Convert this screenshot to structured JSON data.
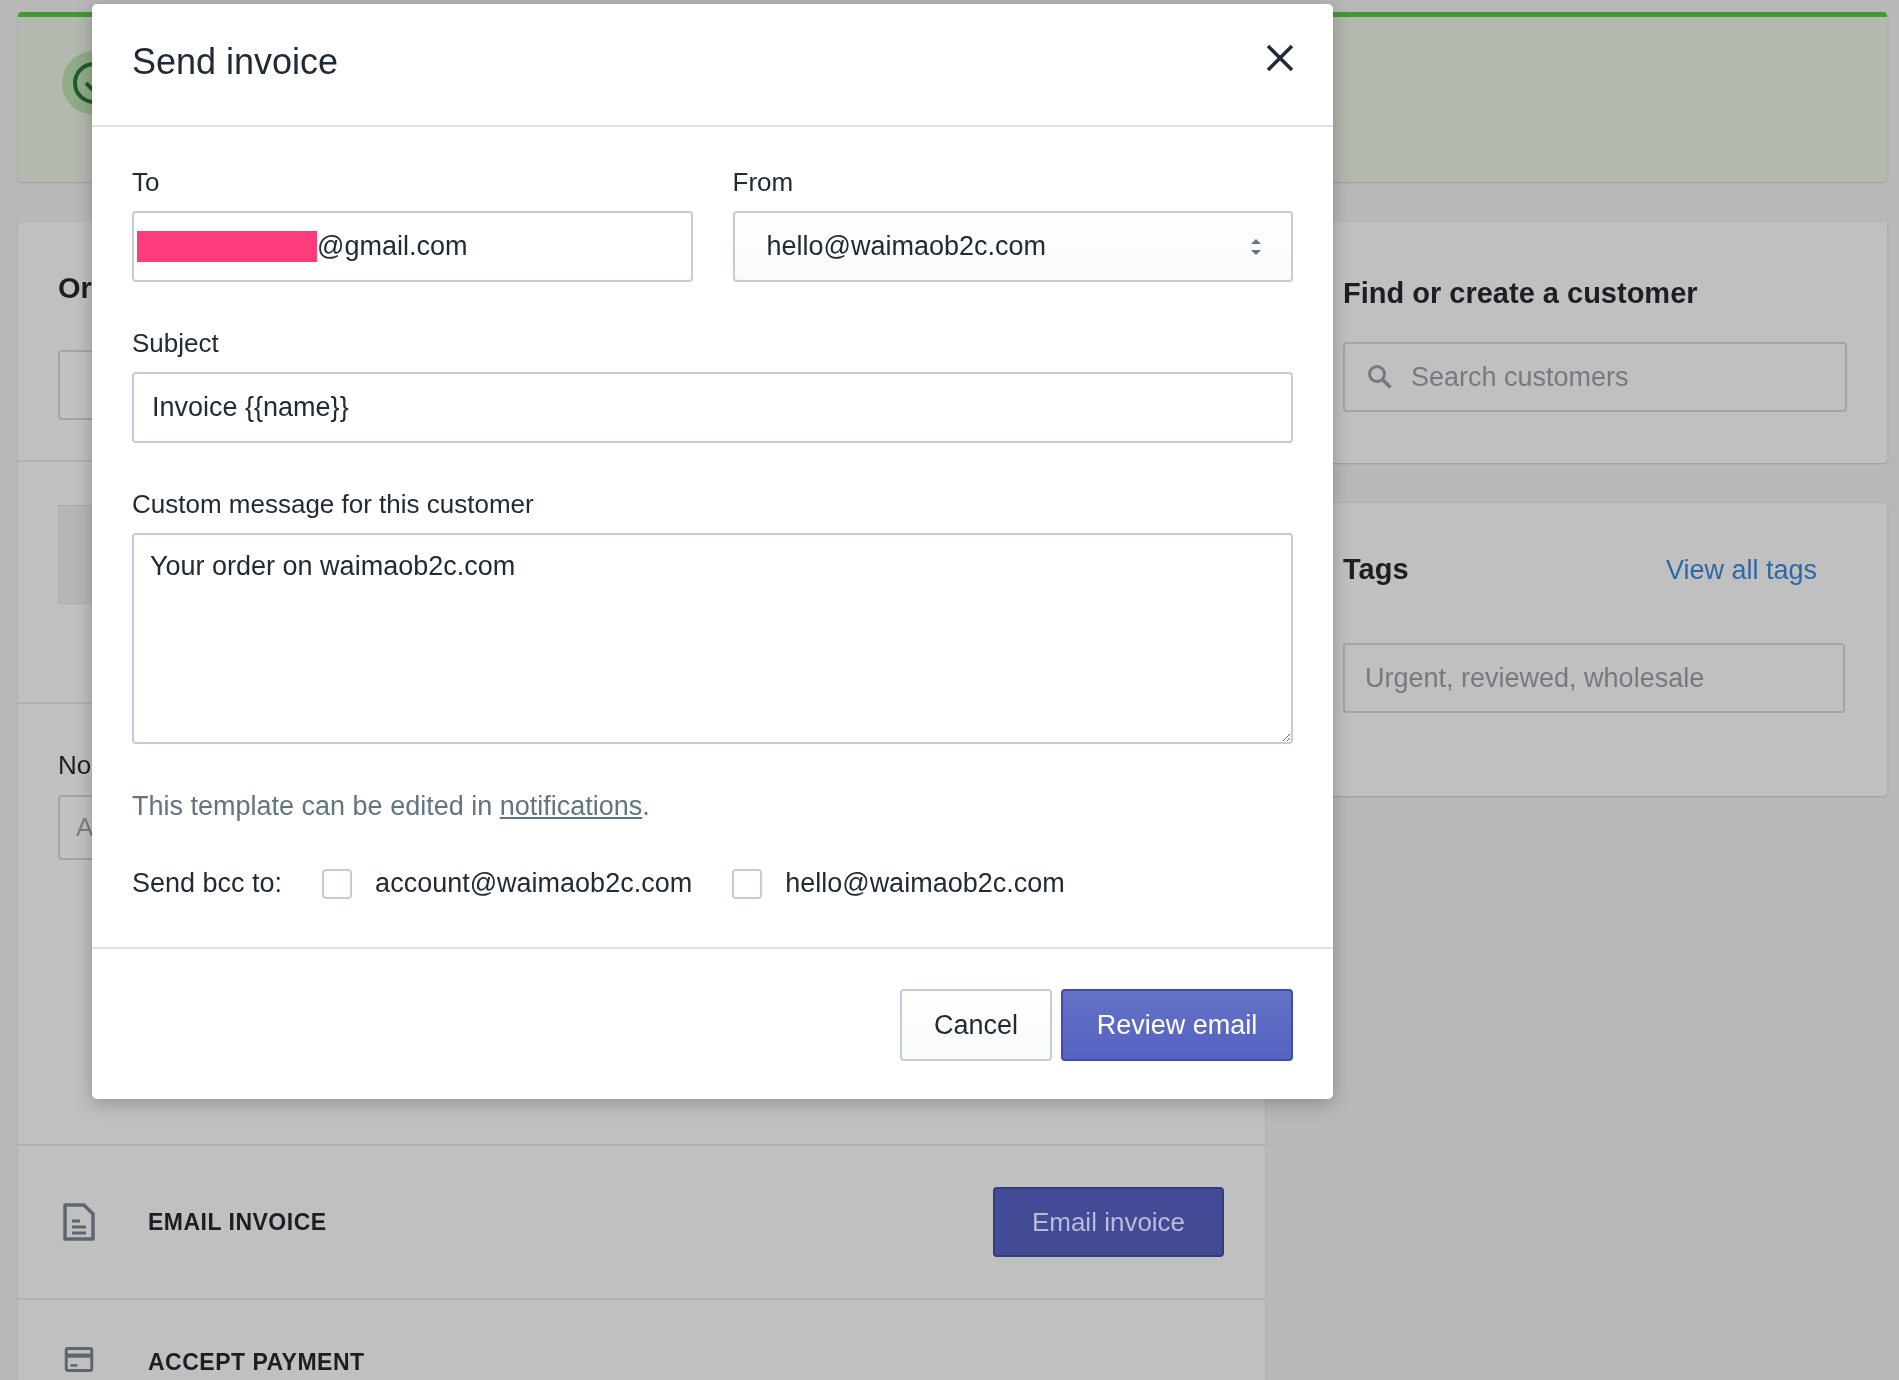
{
  "order_card": {
    "title": "Or",
    "notes_label": "No",
    "notes_placeholder": "A"
  },
  "email_invoice": {
    "label": "EMAIL INVOICE",
    "button": "Email invoice"
  },
  "accept_payment": {
    "label": "ACCEPT PAYMENT"
  },
  "customer_card": {
    "title": "Find or create a customer",
    "search": {
      "placeholder": "Search customers"
    }
  },
  "tags_card": {
    "title": "Tags",
    "link": "View all tags",
    "field": {
      "placeholder": "Urgent, reviewed, wholesale"
    }
  },
  "dialog": {
    "title": "Send invoice",
    "to": {
      "label": "To",
      "value": "@gmail.com",
      "redacted": true
    },
    "from": {
      "label": "From",
      "value": "hello@waimaob2c.com"
    },
    "subject": {
      "label": "Subject",
      "value": "Invoice {{name}}"
    },
    "message": {
      "label": "Custom message for this customer",
      "value": "Your order on waimaob2c.com"
    },
    "help": {
      "text": "This template can be edited in ",
      "link": "notifications",
      "end": "."
    },
    "bcc": {
      "label": "Send bcc to:",
      "options": [
        {
          "label": "account@waimaob2c.com",
          "checked": false
        },
        {
          "label": "hello@waimaob2c.com",
          "checked": false
        }
      ]
    },
    "buttons": [
      {
        "label": "Cancel",
        "kind": "secondary"
      },
      {
        "label": "Review email",
        "kind": "primary"
      }
    ]
  }
}
